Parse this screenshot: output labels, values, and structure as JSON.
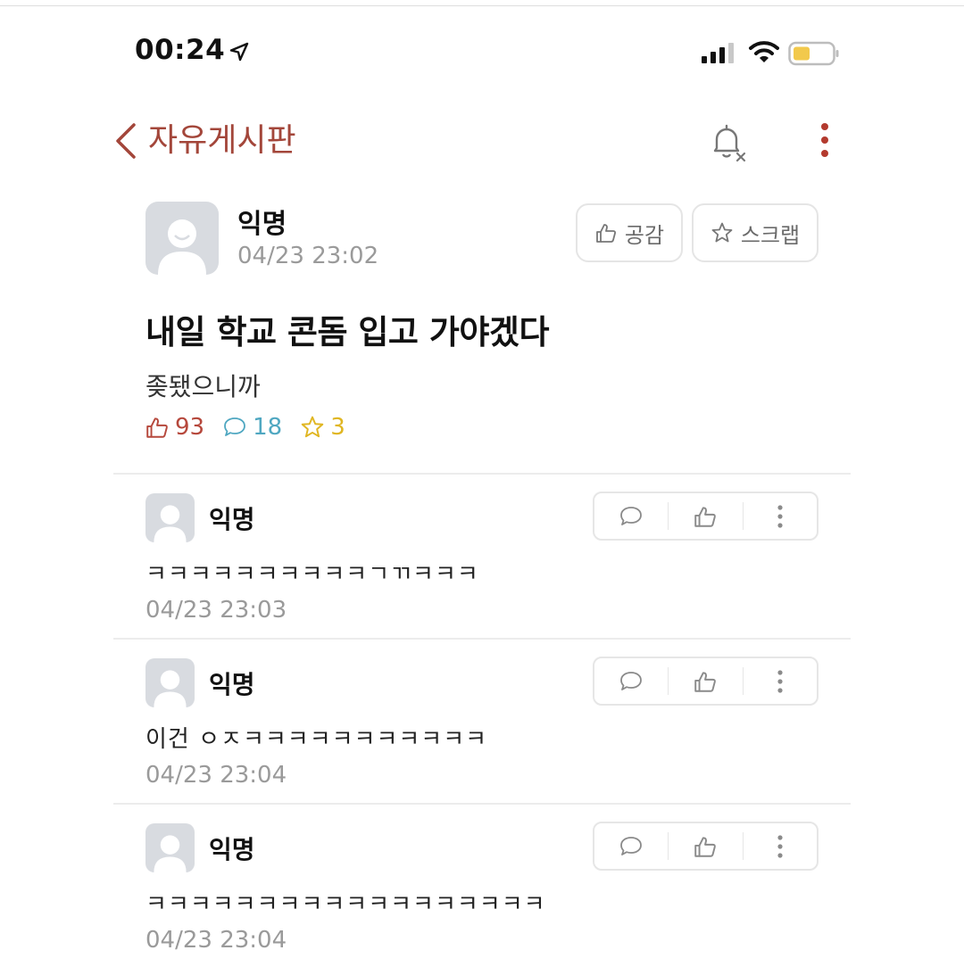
{
  "status_bar": {
    "time": "00:24",
    "battery_color": "#f2c94c"
  },
  "header": {
    "back_label": "자유게시판",
    "accent_color": "#a3463a"
  },
  "post": {
    "author": "익명",
    "timestamp": "04/23 23:02",
    "like_button_label": "공감",
    "scrap_button_label": "스크랩",
    "title": "내일 학교 콘돔 입고 가야겠다",
    "body": "좆됐으니까",
    "likes": "93",
    "comments": "18",
    "scraps": "3",
    "colors": {
      "likes": "#b6483c",
      "comments": "#4fa7c1",
      "scraps": "#e0b622"
    }
  },
  "comments": [
    {
      "author": "익명",
      "text": "ㅋㅋㅋㅋㅋㅋㅋㅋㅋㅋㄱㄲㅋㅋㅋ",
      "timestamp": "04/23 23:03"
    },
    {
      "author": "익명",
      "text": "이건 ㅇㅈㅋㅋㅋㅋㅋㅋㅋㅋㅋㅋㅋ",
      "timestamp": "04/23 23:04"
    },
    {
      "author": "익명",
      "text": "ㅋㅋㅋㅋㅋㅋㅋㅋㅋㅋㅋㅋㅋㅋㅋㅋㅋㅋ",
      "timestamp": "04/23 23:04"
    }
  ],
  "icons": {
    "location": "location-arrow-icon",
    "signal": "cellular-signal-icon",
    "wifi": "wifi-icon",
    "battery": "battery-icon",
    "back": "chevron-left-icon",
    "notifications_off": "bell-off-icon",
    "more": "more-vertical-icon",
    "like": "thumbs-up-icon",
    "scrap": "star-icon",
    "comment": "comment-bubble-icon"
  }
}
